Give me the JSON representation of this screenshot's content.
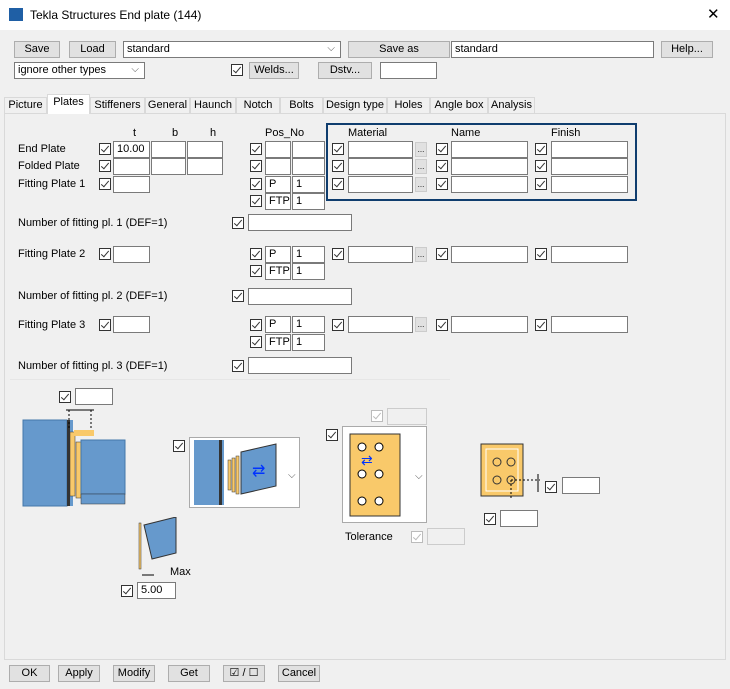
{
  "window": {
    "title": "Tekla Structures  End plate (144)",
    "close": "✕"
  },
  "toolbar": {
    "save": "Save",
    "load": "Load",
    "preset": "standard",
    "save_as": "Save as",
    "save_as_name": "standard",
    "help": "Help...",
    "filter": "ignore other types",
    "welds": "Welds...",
    "dstv": "Dstv...",
    "dstv_value": ""
  },
  "tabs": [
    "Picture",
    "Plates",
    "Stiffeners",
    "General",
    "Haunch",
    "Notch",
    "Bolts",
    "Design type",
    "Holes",
    "Angle box",
    "Analysis"
  ],
  "headers": {
    "t": "t",
    "b": "b",
    "h": "h",
    "pos_no": "Pos_No",
    "material": "Material",
    "name": "Name",
    "finish": "Finish"
  },
  "rows": {
    "end_plate": {
      "label": "End Plate",
      "t": "10.00"
    },
    "folded_plate": {
      "label": "Folded Plate"
    },
    "fitting_plate_1": {
      "label": "Fitting Plate 1",
      "pos_prefix": "P",
      "pos_start": "1",
      "ftpl": "FTPL",
      "ftpl_no": "1"
    },
    "number_1": {
      "label": "Number of fitting pl. 1 (DEF=1)"
    },
    "fitting_plate_2": {
      "label": "Fitting Plate 2",
      "pos_prefix": "P",
      "pos_start": "1",
      "ftpl": "FTPL",
      "ftpl_no": "1"
    },
    "number_2": {
      "label": "Number of fitting pl. 2 (DEF=1)"
    },
    "fitting_plate_3": {
      "label": "Fitting Plate 3",
      "pos_prefix": "P",
      "pos_start": "1",
      "ftpl": "FTPL",
      "ftpl_no": "1"
    },
    "number_3": {
      "label": "Number of fitting pl. 3 (DEF=1)"
    }
  },
  "dots": "...",
  "picture": {
    "max_label": "Max",
    "max_value": "5.00",
    "tolerance_label": "Tolerance"
  },
  "footer": {
    "ok": "OK",
    "apply": "Apply",
    "modify": "Modify",
    "get": "Get",
    "toggle": "☑ / ☐",
    "cancel": "Cancel"
  },
  "colors": {
    "accent": "#0f3d6e",
    "steel": "#6699cc",
    "plate": "#f9c96a"
  }
}
